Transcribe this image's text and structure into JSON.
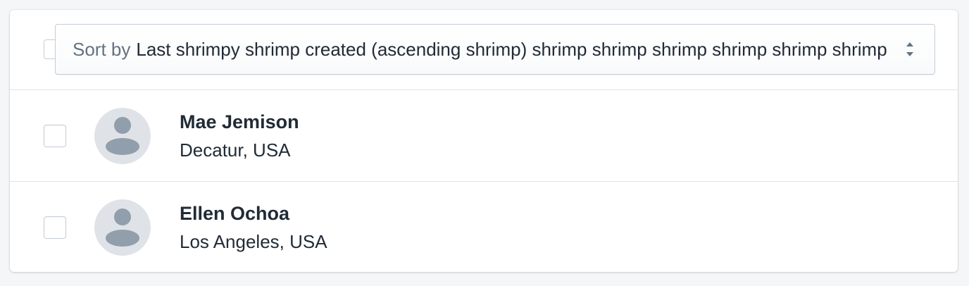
{
  "sort": {
    "prefix": "Sort by",
    "value": "Last shrimpy shrimp created (ascending shrimp) shrimp shrimp shrimp shrimp shrimp shrimp"
  },
  "items": [
    {
      "name": "Mae Jemison",
      "location": "Decatur, USA"
    },
    {
      "name": "Ellen Ochoa",
      "location": "Los Angeles, USA"
    }
  ],
  "colors": {
    "background": "#f4f6f8",
    "border": "#dfe3e8",
    "text": "#212b36",
    "subdued_text": "#637381",
    "avatar_bg": "#dfe3e8",
    "avatar_fg": "#919eab"
  },
  "icons": {
    "sort_arrows": "select-arrows-icon",
    "avatar": "person-icon"
  }
}
